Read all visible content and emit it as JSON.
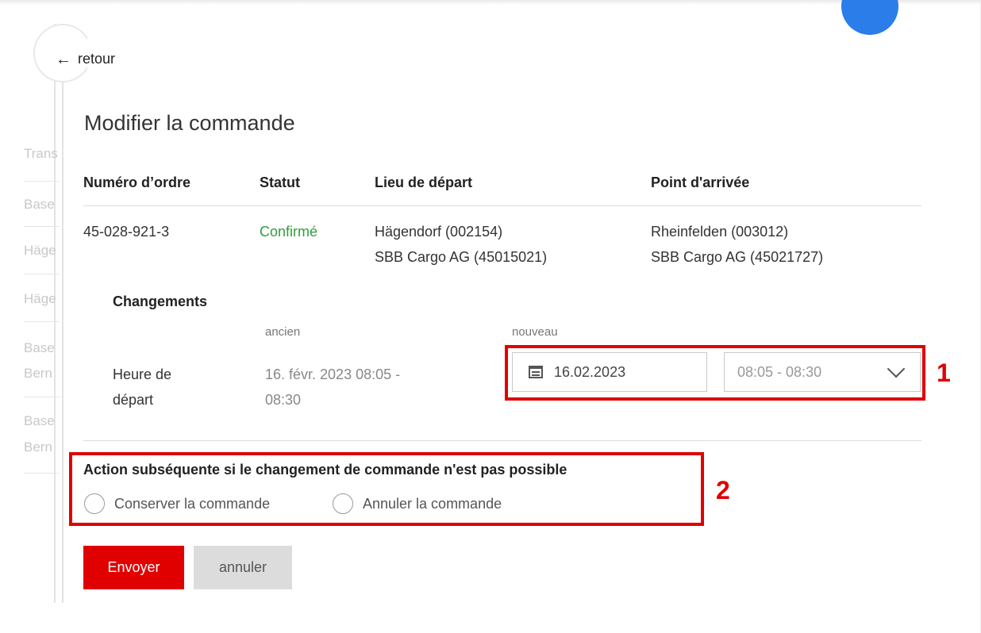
{
  "back": {
    "label": "retour"
  },
  "title": "Modifier la commande",
  "table": {
    "headers": [
      "Numéro d’ordre",
      "Statut",
      "Lieu de départ",
      "Point d'arrivée"
    ],
    "row": {
      "order_number": "45-028-921-3",
      "status": "Confirmé",
      "departure": {
        "line1": "Hägendorf (002154)",
        "line2": "SBB Cargo AG (45015021)"
      },
      "arrival": {
        "line1": "Rheinfelden (003012)",
        "line2": "SBB Cargo AG (45021727)"
      }
    }
  },
  "changes": {
    "title": "Changements",
    "col_old": "ancien",
    "col_new": "nouveau",
    "field_label_line1": "Heure de",
    "field_label_line2": "départ",
    "old_value_line1": "16. févr. 2023  08:05 -",
    "old_value_line2": "08:30",
    "new_date": "16.02.2023",
    "new_time": "08:05 - 08:30"
  },
  "action": {
    "title": "Action subséquente si le changement de commande n'est pas possible",
    "options": [
      "Conserver la commande",
      "Annuler la commande"
    ]
  },
  "buttons": {
    "submit": "Envoyer",
    "cancel": "annuler"
  },
  "callouts": [
    "1",
    "2"
  ],
  "background": {
    "rows": [
      "Trans",
      "Base",
      "Häge",
      "Häge",
      "Base",
      "Bern",
      "Base",
      "Bern"
    ]
  },
  "colors": {
    "accent_red": "#e10000",
    "status_green": "#2f9e3a",
    "badge_blue": "#2b7de9",
    "highlight_red": "#e00000"
  },
  "icons": {
    "back": "arrow-left-icon",
    "date": "calendar-icon",
    "select": "chevron-down-icon"
  }
}
